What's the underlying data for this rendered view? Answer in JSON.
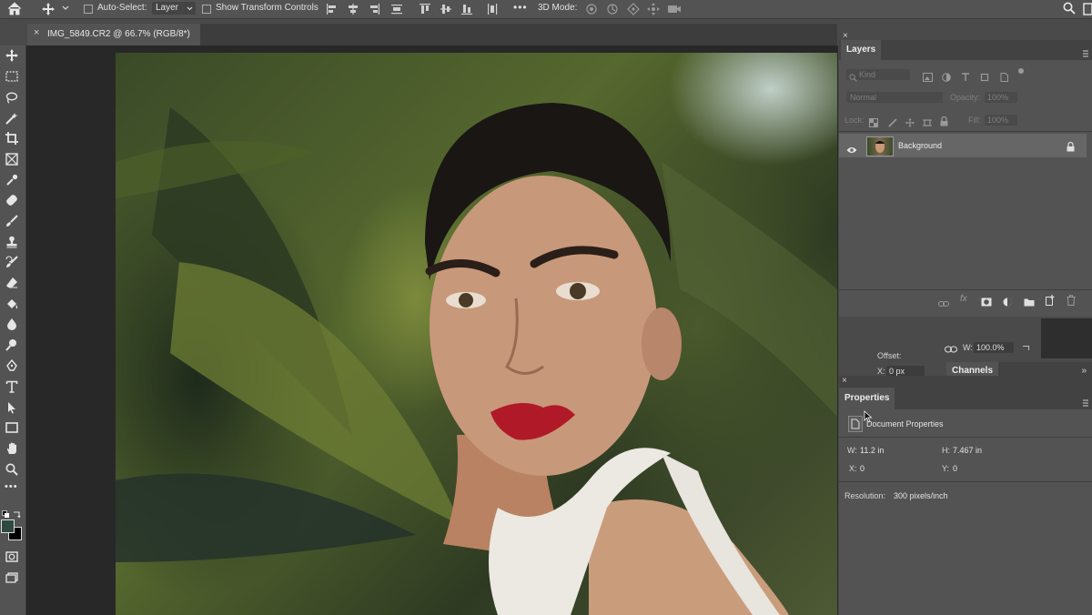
{
  "options_bar": {
    "auto_select_label": "Auto-Select:",
    "auto_select_value": "Layer",
    "transform_label": "Show Transform Controls",
    "mode_3d_label": "3D Mode:",
    "more": "•••"
  },
  "document": {
    "tab_close": "×",
    "tab_title": "IMG_5849.CR2 @ 66.7% (RGB/8*)"
  },
  "toolbar": {
    "tools": [
      "move-tool",
      "marquee-tool",
      "lasso-tool",
      "magic-wand-tool",
      "crop-tool",
      "frame-tool",
      "eyedropper-tool",
      "healing-brush-tool",
      "brush-tool",
      "clone-stamp-tool",
      "history-brush-tool",
      "eraser-tool",
      "paint-bucket-tool",
      "blur-tool",
      "dodge-tool",
      "pen-tool",
      "type-tool",
      "path-selection-tool",
      "rectangle-tool",
      "hand-tool",
      "zoom-tool"
    ],
    "more": "•••",
    "foreground_color": "#2e4a40",
    "background_color": "#000000"
  },
  "layers_panel": {
    "tab_close": "×",
    "title": "Layers",
    "filter_placeholder": "Kind",
    "blend_mode": "Normal",
    "opacity_label": "Opacity:",
    "opacity_value": "100%",
    "lock_label": "Lock:",
    "fill_label": "Fill:",
    "fill_value": "100%",
    "layers": [
      {
        "name": "Background",
        "visible": true,
        "locked": true
      }
    ]
  },
  "behind_panel": {
    "offset_label": "Offset:",
    "w_label": "W:",
    "w_value": "100.0%",
    "x_label": "X:",
    "x_value": "0 px",
    "channels_tab": "Channels",
    "collapse": "»"
  },
  "properties_panel": {
    "tab_close": "×",
    "title": "Properties",
    "section": "Document Properties",
    "w_label": "W:",
    "w_value": "11.2 in",
    "h_label": "H:",
    "h_value": "7.467 in",
    "x_label": "X:",
    "x_value": "0",
    "y_label": "Y:",
    "y_value": "0",
    "resolution_label": "Resolution:",
    "resolution_value": "300 pixels/inch"
  },
  "colors": {
    "lips": "#b01a28",
    "hair": "#1a1614",
    "skin": "#c8987a"
  }
}
